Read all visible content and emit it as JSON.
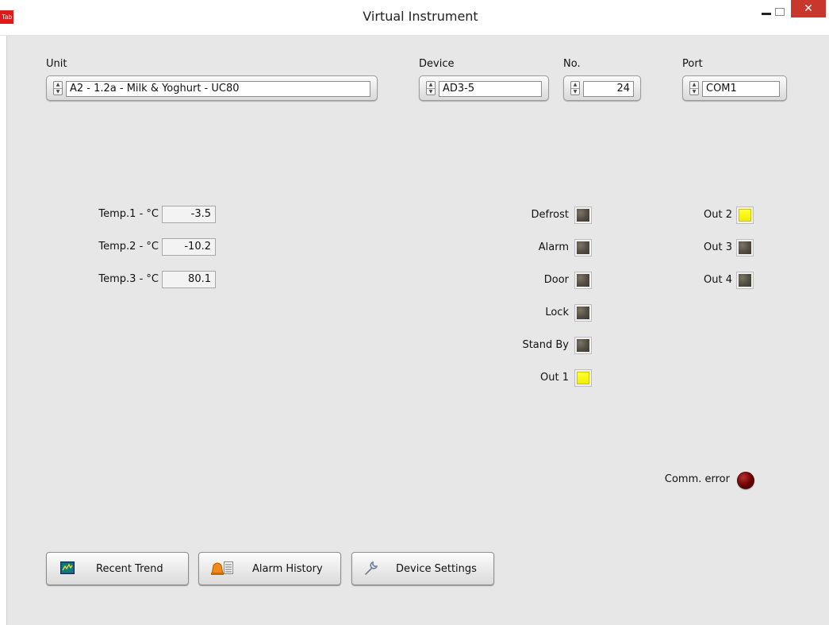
{
  "window": {
    "app_badge": "Tab",
    "title": "Virtual Instrument",
    "close_glyph": "✕"
  },
  "selectors": {
    "unit": {
      "label": "Unit",
      "value": "A2 - 1.2a - Milk & Yoghurt - UC80"
    },
    "device": {
      "label": "Device",
      "value": "AD3-5"
    },
    "number": {
      "label": "No.",
      "value": "24"
    },
    "port": {
      "label": "Port",
      "value": "COM1"
    }
  },
  "temperatures": [
    {
      "label": "Temp.1 - °C",
      "value": "-3.5"
    },
    {
      "label": "Temp.2 - °C",
      "value": "-10.2"
    },
    {
      "label": "Temp.3 - °C",
      "value": "80.1"
    }
  ],
  "status_leds": [
    {
      "label": "Defrost",
      "on": false
    },
    {
      "label": "Alarm",
      "on": false
    },
    {
      "label": "Door",
      "on": false
    },
    {
      "label": "Lock",
      "on": false
    },
    {
      "label": "Stand By",
      "on": false
    },
    {
      "label": "Out 1",
      "on": true
    }
  ],
  "output_leds": [
    {
      "label": "Out 2",
      "on": true
    },
    {
      "label": "Out 3",
      "on": false
    },
    {
      "label": "Out 4",
      "on": false
    }
  ],
  "comm_error": {
    "label": "Comm. error",
    "on": false,
    "color": "#6d0000"
  },
  "buttons": {
    "recent_trend": {
      "label": "Recent Trend",
      "icon": "chart-icon"
    },
    "alarm_history": {
      "label": "Alarm History",
      "icon": "alarm-list-icon"
    },
    "device_settings": {
      "label": "Device Settings",
      "icon": "wrench-icon"
    }
  },
  "colors": {
    "led_on": "#f1ee00",
    "led_off": "#514d42",
    "close_button": "#c9362c"
  }
}
